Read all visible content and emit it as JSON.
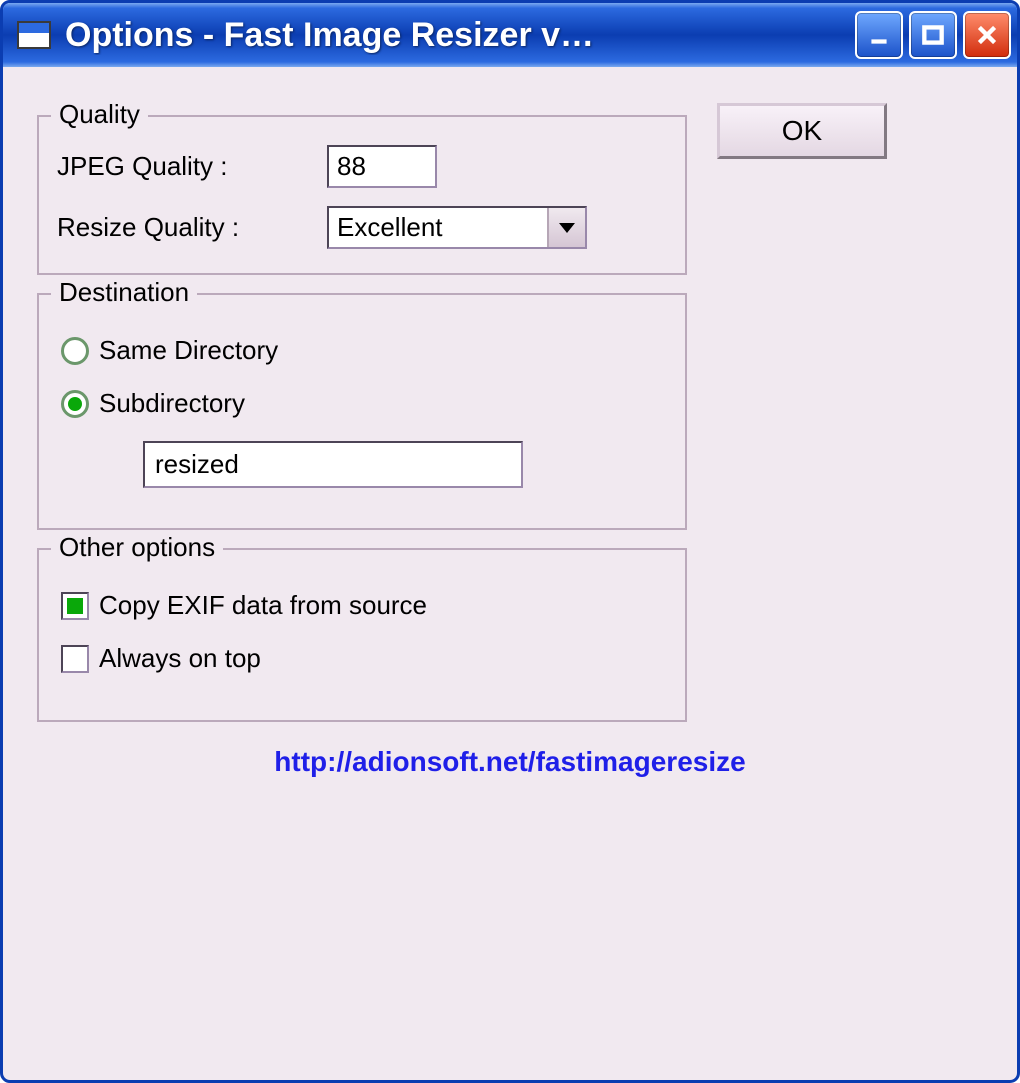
{
  "window": {
    "title": "Options - Fast Image Resizer v…"
  },
  "ok_button": "OK",
  "quality": {
    "legend": "Quality",
    "jpeg_label": "JPEG Quality :",
    "jpeg_value": "88",
    "resize_label": "Resize Quality :",
    "resize_value": "Excellent"
  },
  "destination": {
    "legend": "Destination",
    "same_dir_label": "Same Directory",
    "subdir_label": "Subdirectory",
    "subdir_value": "resized",
    "selected": "subdirectory"
  },
  "other": {
    "legend": "Other options",
    "copy_exif_label": "Copy EXIF data from source",
    "copy_exif_checked": true,
    "always_on_top_label": "Always on top",
    "always_on_top_checked": false
  },
  "footer_link": "http://adionsoft.net/fastimageresize"
}
